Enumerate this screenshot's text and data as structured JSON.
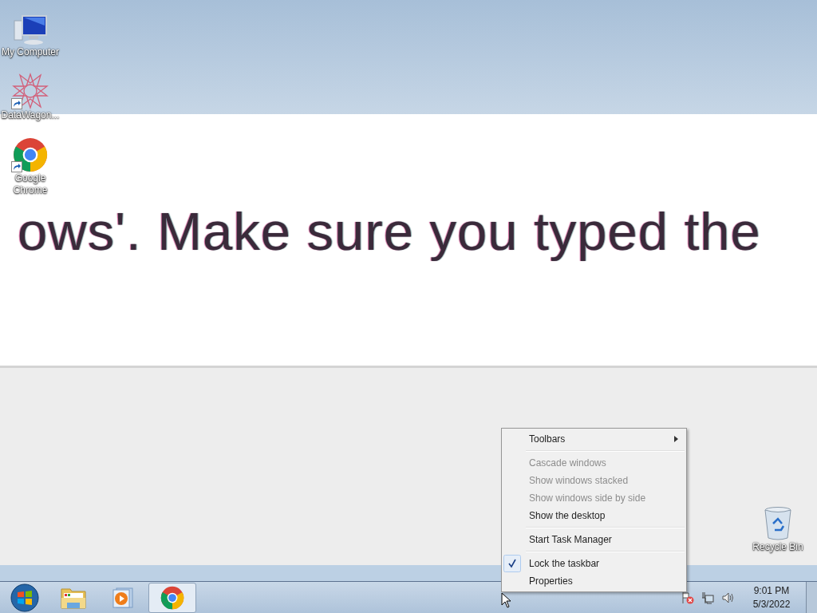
{
  "desktop_icons": [
    {
      "kind": "computer",
      "label": "My Computer",
      "shortcut": false
    },
    {
      "kind": "star",
      "label": "DataWagon...",
      "shortcut": true
    },
    {
      "kind": "chrome",
      "label": "Google Chrome",
      "shortcut": true
    },
    {
      "kind": "recycle",
      "label": "Recycle Bin",
      "shortcut": false
    }
  ],
  "background_window": {
    "text": "ows'. Make sure you typed the"
  },
  "context_menu": {
    "groups": [
      [
        {
          "label": "Toolbars",
          "disabled": false,
          "checked": false,
          "submenu": true
        }
      ],
      [
        {
          "label": "Cascade windows",
          "disabled": true,
          "checked": false,
          "submenu": false
        },
        {
          "label": "Show windows stacked",
          "disabled": true,
          "checked": false,
          "submenu": false
        },
        {
          "label": "Show windows side by side",
          "disabled": true,
          "checked": false,
          "submenu": false
        },
        {
          "label": "Show the desktop",
          "disabled": false,
          "checked": false,
          "submenu": false
        }
      ],
      [
        {
          "label": "Start Task Manager",
          "disabled": false,
          "checked": false,
          "submenu": false
        }
      ],
      [
        {
          "label": "Lock the taskbar",
          "disabled": false,
          "checked": true,
          "submenu": false
        },
        {
          "label": "Properties",
          "disabled": false,
          "checked": false,
          "submenu": false
        }
      ]
    ]
  },
  "taskbar": {
    "items": [
      {
        "kind": "explorer",
        "selected": false
      },
      {
        "kind": "media",
        "selected": false
      },
      {
        "kind": "chrome",
        "selected": true
      }
    ],
    "tray": [
      {
        "kind": "flag"
      },
      {
        "kind": "network"
      },
      {
        "kind": "volume"
      }
    ],
    "clock": {
      "time": "9:01 PM",
      "date": "5/3/2022"
    }
  }
}
